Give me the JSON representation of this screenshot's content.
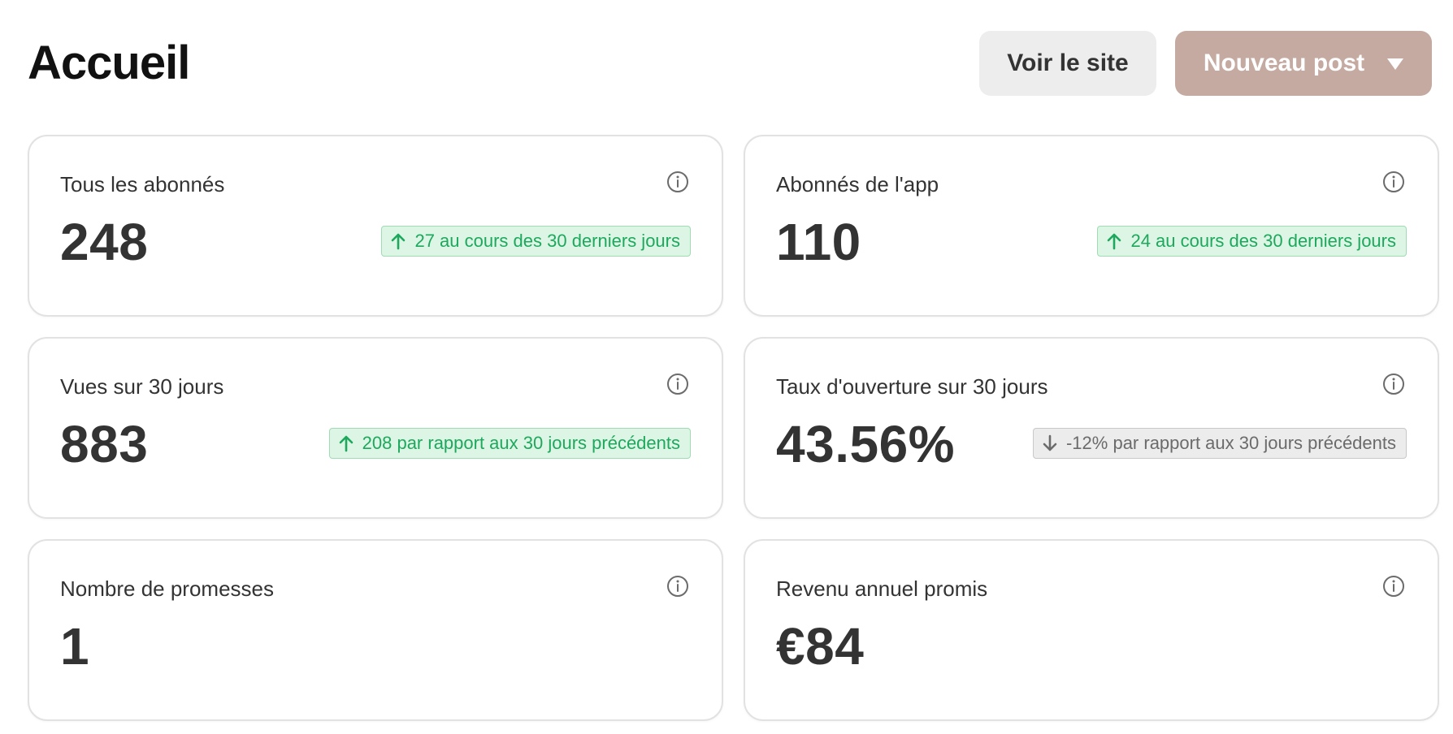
{
  "header": {
    "title": "Accueil",
    "view_site_label": "Voir le site",
    "new_post_label": "Nouveau post"
  },
  "colors": {
    "primary_button": "#c5aaa1",
    "positive_delta": "#1ea85d",
    "neutral_delta": "#6b6b6b"
  },
  "cards": [
    {
      "label": "Tous les abonnés",
      "value": "248",
      "delta": "27 au cours des 30 derniers jours",
      "trend": "up",
      "icon": "info-icon"
    },
    {
      "label": "Abonnés de l'app",
      "value": "110",
      "delta": "24 au cours des 30 derniers jours",
      "trend": "up",
      "icon": "info-icon"
    },
    {
      "label": "Vues sur 30 jours",
      "value": "883",
      "delta": "208 par rapport aux 30 jours précédents",
      "trend": "up",
      "icon": "info-icon"
    },
    {
      "label": "Taux d'ouverture sur 30 jours",
      "value": "43.56%",
      "delta": "-12% par rapport aux 30 jours précédents",
      "trend": "down",
      "icon": "info-icon"
    },
    {
      "label": "Nombre de promesses",
      "value": "1",
      "icon": "info-icon"
    },
    {
      "label": "Revenu annuel promis",
      "value": "€84",
      "icon": "info-icon"
    }
  ]
}
